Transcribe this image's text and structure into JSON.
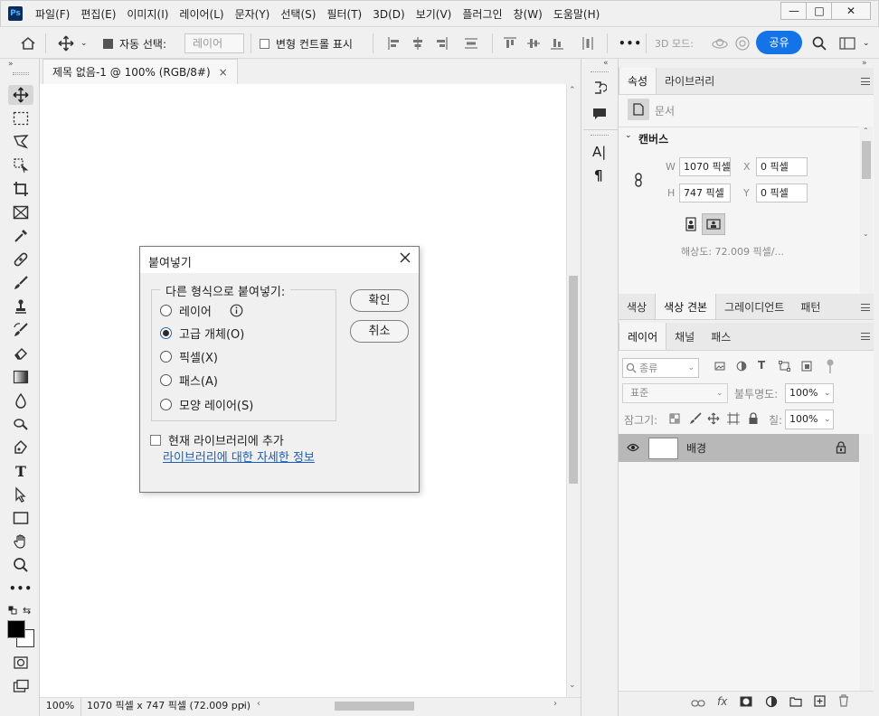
{
  "app": {
    "logo": "Ps"
  },
  "menu": [
    "파일(F)",
    "편집(E)",
    "이미지(I)",
    "레이어(L)",
    "문자(Y)",
    "선택(S)",
    "필터(T)",
    "3D(D)",
    "보기(V)",
    "플러그인",
    "창(W)",
    "도움말(H)"
  ],
  "window_buttons": {
    "minimize": "—",
    "maximize": "□",
    "close": "✕"
  },
  "options": {
    "auto_select_label": "자동 선택:",
    "auto_select_value": "레이어",
    "transform_label": "변형 컨트롤 표시",
    "more": "•••",
    "mode_3d": "3D 모드:",
    "share": "공유"
  },
  "document": {
    "tab_title": "제목 없음-1 @ 100% (RGB/8#)",
    "zoom": "100%",
    "status": "1070 픽셀 x 747 픽셀 (72.009 ppi)"
  },
  "properties": {
    "tabs": [
      "속성",
      "라이브러리"
    ],
    "doc_label": "문서",
    "section": "캔버스",
    "w_label": "W",
    "w_value": "1070 픽셀",
    "h_label": "H",
    "h_value": "747 픽셀",
    "x_label": "X",
    "x_value": "0 픽셀",
    "y_label": "Y",
    "y_value": "0 픽셀",
    "resolution": "해상도: 72.009 픽셀/..."
  },
  "swatch_tabs": [
    "색상",
    "색상 견본",
    "그레이디언트",
    "패턴"
  ],
  "layers": {
    "tabs": [
      "레이어",
      "채널",
      "패스"
    ],
    "filter_kind": "종류",
    "blend_mode": "표준",
    "opacity_label": "불투명도:",
    "opacity_value": "100%",
    "lock_label": "잠그기:",
    "fill_label": "칠:",
    "fill_value": "100%",
    "items": [
      {
        "name": "배경"
      }
    ]
  },
  "dialog": {
    "title": "붙여넣기",
    "group_label": "다른 형식으로 붙여넣기:",
    "options": [
      "레이어",
      "고급 개체(O)",
      "픽셀(X)",
      "패스(A)",
      "모양 레이어(S)"
    ],
    "selected": "고급 개체(O)",
    "ok": "확인",
    "cancel": "취소",
    "add_to_library": "현재 라이브러리에 추가",
    "library_link": "라이브러리에 대한 자세한 정보"
  }
}
